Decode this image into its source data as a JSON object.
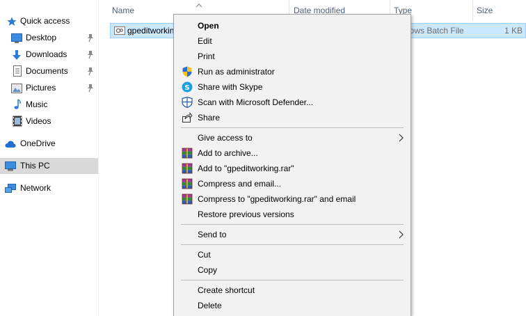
{
  "sidebar": {
    "items": [
      {
        "label": "Quick access",
        "icon": "star-icon"
      },
      {
        "label": "Desktop",
        "icon": "desktop-icon",
        "pinned": true
      },
      {
        "label": "Downloads",
        "icon": "download-icon",
        "pinned": true
      },
      {
        "label": "Documents",
        "icon": "documents-icon",
        "pinned": true
      },
      {
        "label": "Pictures",
        "icon": "pictures-icon",
        "pinned": true
      },
      {
        "label": "Music",
        "icon": "music-icon"
      },
      {
        "label": "Videos",
        "icon": "videos-icon"
      },
      {
        "label": "OneDrive",
        "icon": "cloud-icon"
      },
      {
        "label": "This PC",
        "icon": "computer-icon",
        "selected": true
      },
      {
        "label": "Network",
        "icon": "network-icon"
      }
    ]
  },
  "columns": {
    "name": "Name",
    "date_modified": "Date modified",
    "type": "Type",
    "size": "Size"
  },
  "file": {
    "name": "gpeditworkin",
    "type": "lows Batch File",
    "size": "1 KB"
  },
  "context_menu": {
    "open": "Open",
    "edit": "Edit",
    "print": "Print",
    "run_as_admin": "Run as administrator",
    "share_skype": "Share with Skype",
    "scan_defender": "Scan with Microsoft Defender...",
    "share": "Share",
    "give_access": "Give access to",
    "add_archive": "Add to archive...",
    "add_rar": "Add to \"gpeditworking.rar\"",
    "compress_email": "Compress and email...",
    "compress_rar_email": "Compress to \"gpeditworking.rar\" and email",
    "restore_versions": "Restore previous versions",
    "send_to": "Send to",
    "cut": "Cut",
    "copy": "Copy",
    "create_shortcut": "Create shortcut",
    "delete": "Delete"
  },
  "colors": {
    "selection_bg": "#cce8ff",
    "selection_border": "#99d1ff",
    "menu_bg": "#f2f2f2",
    "header_text": "#4c607a",
    "nav_selected": "#d9d9d9"
  }
}
